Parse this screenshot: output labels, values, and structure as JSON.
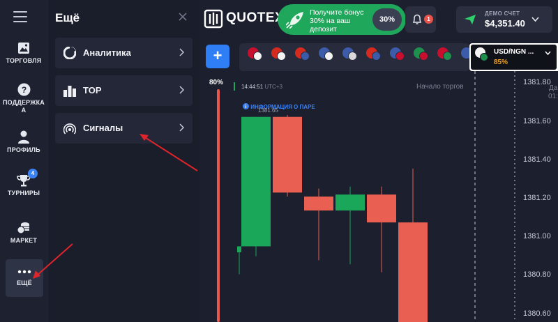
{
  "sidebar": {
    "items": [
      {
        "label": "ТОРГОВЛЯ",
        "icon": "chart-image-icon"
      },
      {
        "label": "ПОДДЕРЖКА",
        "label_line2": "А",
        "icon": "help-icon"
      },
      {
        "label": "ПРОФИЛЬ",
        "icon": "user-icon"
      },
      {
        "label": "ТУРНИРЫ",
        "icon": "trophy-icon",
        "badge": "4"
      },
      {
        "label": "МАРКЕТ",
        "icon": "coins-icon"
      },
      {
        "label": "ЕЩЁ",
        "icon": "more-dots-icon"
      }
    ]
  },
  "panel": {
    "title": "Ещё",
    "items": [
      {
        "label": "Аналитика",
        "icon": "pie-chart-icon"
      },
      {
        "label": "TOP",
        "icon": "bar-ranking-icon"
      },
      {
        "label": "Сигналы",
        "icon": "signal-icon"
      }
    ]
  },
  "header": {
    "logo_text": "QUOTEX",
    "bonus": {
      "line1": "Получите бонус",
      "line2": "30% на ваш",
      "line3": "депозит",
      "percent": "30%"
    },
    "notifications_badge": "1",
    "account": {
      "label": "ДЕМО СЧЕТ",
      "balance": "$4,351.40"
    }
  },
  "asset": {
    "name": "USD/NGN ...",
    "payout": "85%"
  },
  "chart": {
    "payout_label": "80%",
    "time_label": "14:44:51",
    "timezone_label": "UTC+3",
    "start_label": "Начало торгов",
    "info_label": "ИНФОРМАЦИЯ О ПАРЕ",
    "price_tag": "1381.65",
    "right_cut_label_1": "Да",
    "right_cut_label_2": "01:0"
  },
  "chart_data": {
    "type": "candlestick",
    "y_ticks": [
      "1381.80",
      "1381.60",
      "1381.40",
      "1381.20",
      "1381.00",
      "1380.80",
      "1380.60"
    ],
    "ylim": [
      1380.57,
      1381.83
    ],
    "candles": [
      {
        "open": 1380.92,
        "high": 1380.93,
        "low": 1380.81,
        "close": 1380.95,
        "direction": "up"
      },
      {
        "open": 1380.95,
        "high": 1381.6,
        "low": 1380.9,
        "close": 1381.6,
        "direction": "up"
      },
      {
        "open": 1381.6,
        "high": 1381.61,
        "low": 1381.2,
        "close": 1381.22,
        "direction": "down"
      },
      {
        "open": 1381.2,
        "high": 1381.24,
        "low": 1380.88,
        "close": 1381.13,
        "direction": "down"
      },
      {
        "open": 1381.13,
        "high": 1381.25,
        "low": 1380.86,
        "close": 1381.21,
        "direction": "up"
      },
      {
        "open": 1381.21,
        "high": 1381.25,
        "low": 1380.82,
        "close": 1381.07,
        "direction": "down"
      },
      {
        "open": 1381.07,
        "high": 1381.34,
        "low": 1380.69,
        "close": 1380.57,
        "direction": "down"
      }
    ],
    "colors": {
      "up": "#1aa75a",
      "down": "#e95f52"
    }
  },
  "colors": {
    "accent": "#2f7ef5",
    "bonus": "#1fa85c",
    "payout": "#f5a623",
    "badge_red": "#e6534b"
  }
}
